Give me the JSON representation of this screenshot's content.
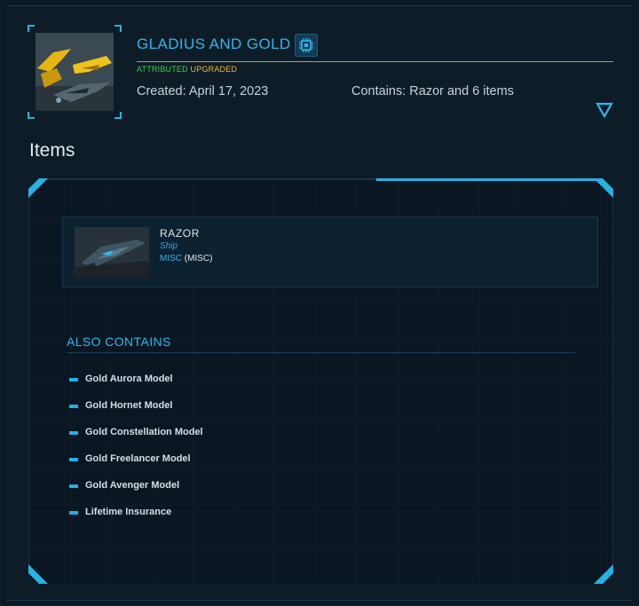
{
  "package": {
    "title": "GLADIUS AND GOLD",
    "badge_attributed": "ATTRIBUTED",
    "badge_upgraded": "UPGRADED",
    "created": "Created: April 17, 2023",
    "contains": "Contains: Razor and 6 items",
    "chip_icon": "chip-icon",
    "expand_icon": "chevron-down-icon"
  },
  "items_section": {
    "heading": "Items",
    "item": {
      "name": "RAZOR",
      "type": "Ship",
      "manufacturer_link": "MISC",
      "manufacturer_code": "(MISC)"
    }
  },
  "also_contains": {
    "title": "ALSO CONTAINS",
    "items": [
      "Gold Aurora Model",
      "Gold Hornet Model",
      "Gold Constellation Model",
      "Gold Freelancer Model",
      "Gold Avenger Model",
      "Lifetime Insurance"
    ]
  },
  "colors": {
    "accent": "#2fb8ea",
    "attributed": "#39d24a",
    "upgraded": "#f2b62f",
    "background": "#0d1c27"
  }
}
